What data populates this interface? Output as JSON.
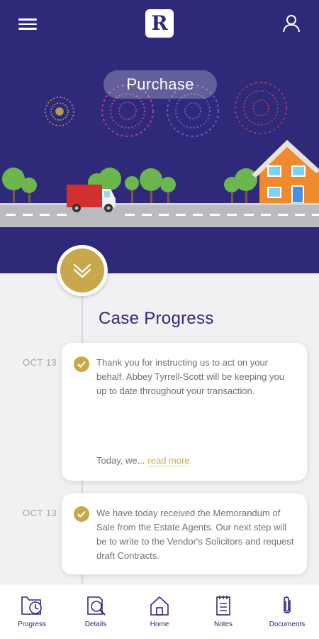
{
  "header": {
    "logo_text": "R",
    "banner_title": "Purchase"
  },
  "colors": {
    "primary": "#2e2a79",
    "accent": "#c9a84c",
    "background": "#f1f1f3"
  },
  "icons": {
    "menu": "hamburger-menu-icon",
    "user": "user-icon",
    "toggle": "chevron-double-down-icon",
    "check": "check-icon"
  },
  "main": {
    "section_title": "Case Progress",
    "entries": [
      {
        "date": "OCT 13",
        "text": "Thank you for instructing us to act on your behalf.  Abbey Tyrrell-Scott will be keeping you up to date throughout your transaction.",
        "footer_text": "Today, we...",
        "read_more": "read more"
      },
      {
        "date": "OCT 13",
        "text": "We have today received the Memorandum of Sale from the Estate Agents.  Our next step will be to write to the Vendor's Solicitors and request draft Contracts."
      }
    ]
  },
  "bottom_nav": [
    {
      "label": "Progress",
      "icon": "progress-icon"
    },
    {
      "label": "Details",
      "icon": "details-icon"
    },
    {
      "label": "Home",
      "icon": "home-icon"
    },
    {
      "label": "Notes",
      "icon": "notes-icon"
    },
    {
      "label": "Documents",
      "icon": "documents-icon"
    }
  ]
}
